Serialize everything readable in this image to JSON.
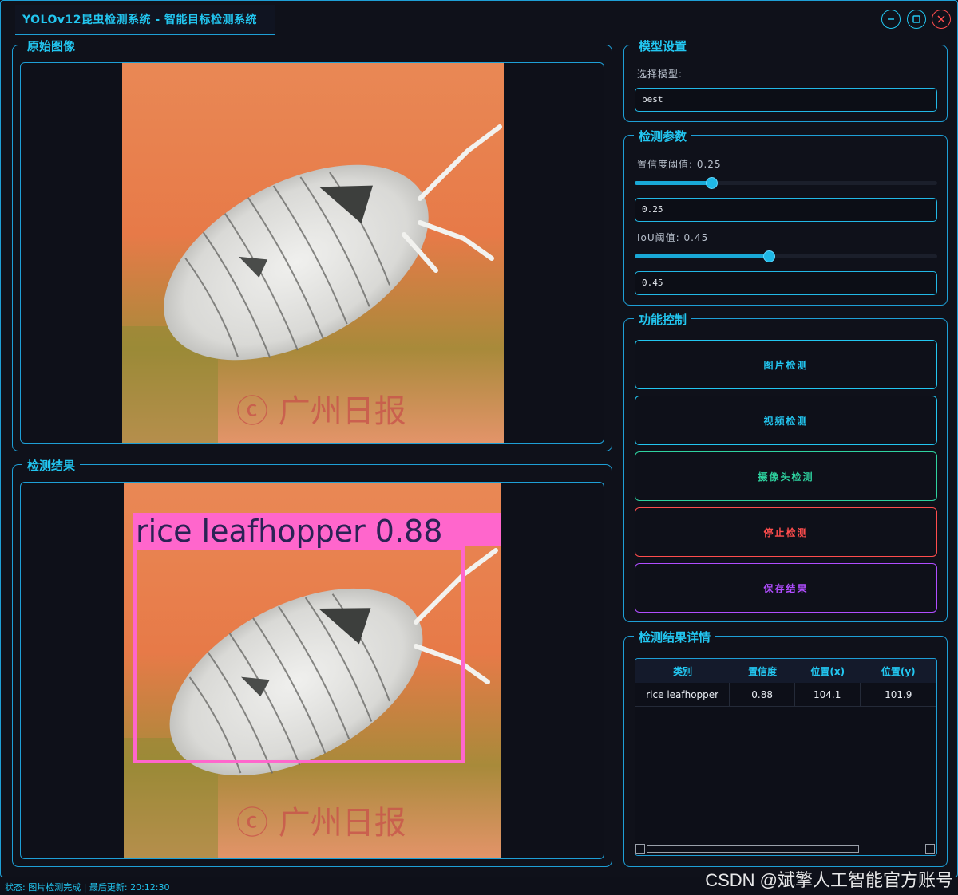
{
  "window": {
    "title": "YOLOv12昆虫检测系统 - 智能目标检测系统",
    "minimize_icon": "minimize-icon",
    "maximize_icon": "maximize-icon",
    "close_icon": "close-icon"
  },
  "original_panel": {
    "title": "原始图像"
  },
  "result_panel": {
    "title": "检测结果",
    "detection_label": "rice leafhopper 0.88",
    "box_color": "#ff66cc"
  },
  "model_settings": {
    "title": "模型设置",
    "select_label": "选择模型:",
    "selected_model": "best"
  },
  "detect_params": {
    "title": "检测参数",
    "conf_label": "置信度阈值: 0.25",
    "conf_value": "0.25",
    "conf_fraction": 0.25,
    "iou_label": "IoU阈值: 0.45",
    "iou_value": "0.45",
    "iou_fraction": 0.45
  },
  "controls": {
    "title": "功能控制",
    "image_detect": "图片检测",
    "video_detect": "视频检测",
    "camera_detect": "摄像头检测",
    "stop_detect": "停止检测",
    "save_results": "保存结果",
    "colors": {
      "image": "#22c6f0",
      "video": "#22c6f0",
      "camera": "#2ed3a0",
      "stop": "#ff4d4d",
      "save": "#b04dff"
    }
  },
  "details": {
    "title": "检测结果详情",
    "columns": [
      "类别",
      "置信度",
      "位置(x)",
      "位置(y)"
    ],
    "rows": [
      [
        "rice leafhopper",
        "0.88",
        "104.1",
        "101.9"
      ]
    ]
  },
  "status": {
    "text": "状态: 图片检测完成 | 最后更新: 20:12:30"
  },
  "watermark": "CSDN @斌擎人工智能官方账号"
}
